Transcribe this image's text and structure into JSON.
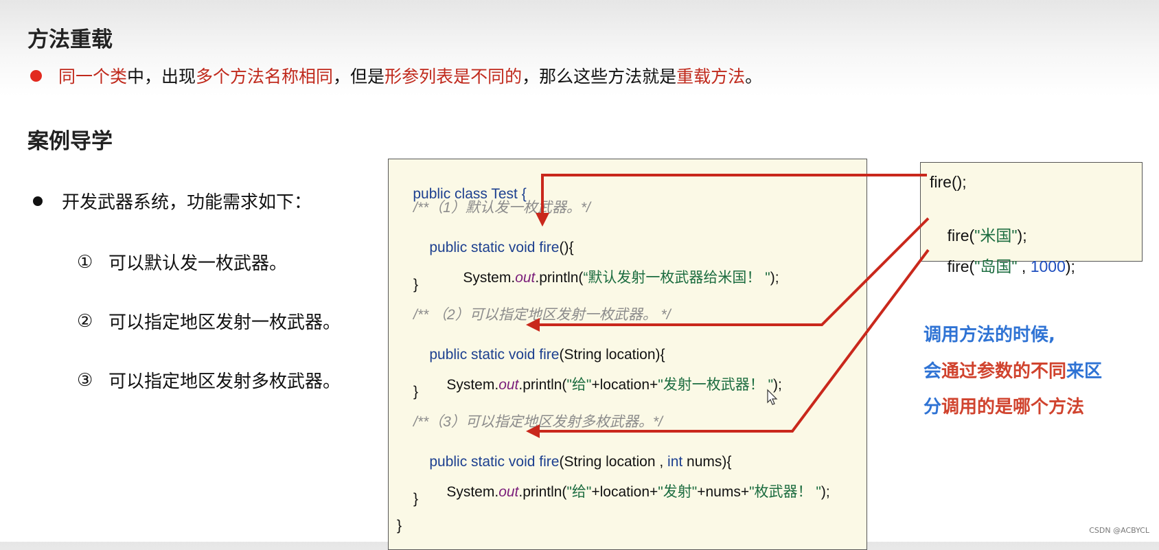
{
  "headings": {
    "overload": "方法重载",
    "case": "案例导学"
  },
  "definition": {
    "segments": [
      {
        "text": "同一个类",
        "red": true
      },
      {
        "text": "中，出现",
        "red": false
      },
      {
        "text": "多个方法名称相同",
        "red": true
      },
      {
        "text": "，但是",
        "red": false
      },
      {
        "text": "形参列表是不同的",
        "red": true
      },
      {
        "text": "，那么这些方法就是",
        "red": false
      },
      {
        "text": "重载方法",
        "red": true
      },
      {
        "text": "。",
        "red": false
      }
    ]
  },
  "bullet": "开发武器系统，功能需求如下：",
  "requirements": [
    {
      "num": "①",
      "text": "可以默认发一枚武器。"
    },
    {
      "num": "②",
      "text": "可以指定地区发射一枚武器。"
    },
    {
      "num": "③",
      "text": "可以指定地区发射多枚武器。"
    }
  ],
  "code": {
    "l1": "public class Test {",
    "l2": "/**（1）默认发一枚武器。*/",
    "l3_kw": "public static void ",
    "l3_name": "fire",
    "l3_rest": "(){",
    "l4_a": "System.",
    "l4_b": "out",
    "l4_c": ".println(",
    "l4_str": "“默认发射一枚武器给米国！ \"",
    "l4_end": ");",
    "l5": "}",
    "l6": "/** （2）可以指定地区发射一枚武器。 */",
    "l7_kw": "public static void ",
    "l7_name": "fire",
    "l7_rest": "(String location){",
    "l8_a": "System.",
    "l8_b": "out",
    "l8_c": ".println(",
    "l8_s1": "\"给\"",
    "l8_m": "+location+",
    "l8_s2": "\"发射一枚武器！ \"",
    "l8_end": ");",
    "l9": "}",
    "l10": "/**（3）可以指定地区发射多枚武器。*/",
    "l11_kw": "public static void ",
    "l11_name": "fire",
    "l11_rest": "(String location , ",
    "l11_int": "int",
    "l11_end": " nums){",
    "l12_a": "System.",
    "l12_b": "out",
    "l12_c": ".println(",
    "l12_s1": "\"给\"",
    "l12_m1": "+location+",
    "l12_s2": "\"发射\"",
    "l12_m2": "+nums+",
    "l12_s3": "\"枚武器！ \"",
    "l12_end": ");",
    "l13": "}",
    "l14": "}"
  },
  "calls": {
    "c1": "fire();",
    "c2_a": "fire(",
    "c2_s": "\"米国\"",
    "c2_b": ");",
    "c3_a": "fire(",
    "c3_s": "\"岛国\"",
    "c3_m": " , ",
    "c3_n": "1000",
    "c3_b": ");"
  },
  "note": {
    "line1": "调用方法的时候,",
    "line2": [
      {
        "text": "会",
        "color": "blue"
      },
      {
        "text": "通过参数的不同",
        "color": "red"
      },
      {
        "text": "来区",
        "color": "blue"
      }
    ],
    "line3": [
      {
        "text": "分",
        "color": "blue"
      },
      {
        "text": "调用的是哪个方法",
        "color": "red"
      }
    ]
  },
  "watermark": "CSDN @ACBYCL",
  "colors": {
    "accent_red": "#c0291c",
    "arrow_red": "#c9281c",
    "note_blue": "#2f73d4",
    "code_bg": "#fbf9e6"
  }
}
